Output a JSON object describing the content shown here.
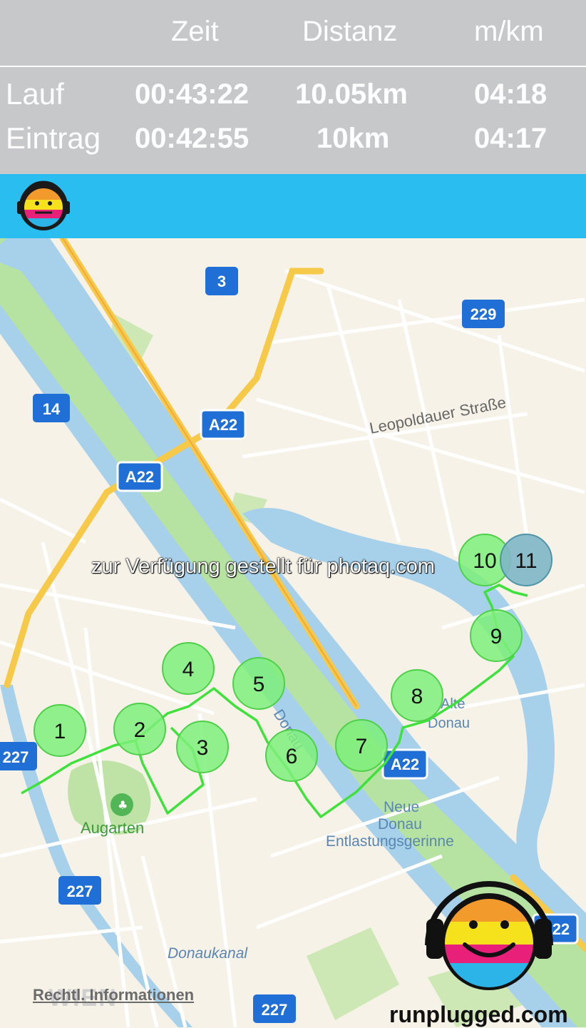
{
  "stats": {
    "headers": {
      "zeit": "Zeit",
      "distanz": "Distanz",
      "pace": "m/km"
    },
    "rows": [
      {
        "label": "Lauf",
        "zeit": "00:43:22",
        "distanz": "10.05km",
        "pace": "04:18"
      },
      {
        "label": "Eintrag",
        "zeit": "00:42:55",
        "distanz": "10km",
        "pace": "04:17"
      }
    ]
  },
  "map": {
    "street_labels": [
      "Leopoldauer Straße",
      "Augarten",
      "Donau",
      "Alte Donau",
      "Neue Donau Entlastungsgerinne",
      "Donaukanal"
    ],
    "alte_donau": [
      "Alte",
      "Donau"
    ],
    "neue_donau": [
      "Neue",
      "Donau",
      "Entlastungsgerinne"
    ],
    "city_label": "WIEN",
    "shields": {
      "r3": "3",
      "r229": "229",
      "r14": "14",
      "a22a": "A22",
      "a22b": "A22",
      "a22c": "A22",
      "a22d": "A22",
      "r227a": "227",
      "r227b": "227",
      "r227c": "227"
    },
    "km_markers": [
      "1",
      "2",
      "3",
      "4",
      "5",
      "6",
      "7",
      "8",
      "9",
      "10",
      "11"
    ],
    "legal_link": "Rechtl. Informationen"
  },
  "watermark": "zur Verfügung gestellt für photaq.com",
  "brand": "runplugged.com",
  "colors": {
    "accent": "#29bdf0",
    "marker": "#7ef07a",
    "track": "#3ee23a",
    "final_marker": "#7fb6c6"
  }
}
